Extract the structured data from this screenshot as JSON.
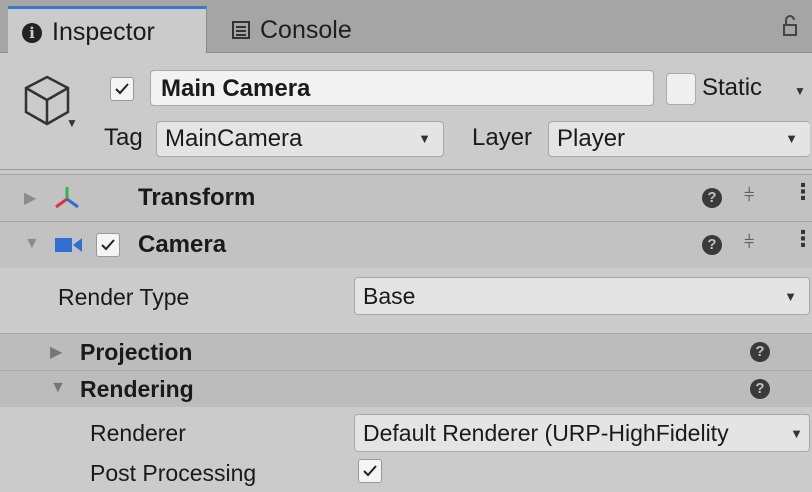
{
  "tabs": [
    {
      "label": "Inspector",
      "icon": "info-icon",
      "active": true
    },
    {
      "label": "Console",
      "icon": "console-icon",
      "active": false
    }
  ],
  "header": {
    "active": true,
    "name": "Main Camera",
    "static_label": "Static",
    "static_checked": false,
    "tag_label": "Tag",
    "tag_value": "MainCamera",
    "layer_label": "Layer",
    "layer_value": "Player"
  },
  "components": {
    "transform": {
      "title": "Transform",
      "expanded": false
    },
    "camera": {
      "title": "Camera",
      "expanded": true,
      "enabled": true
    }
  },
  "camera_props": {
    "render_type_label": "Render Type",
    "render_type_value": "Base",
    "projection_label": "Projection",
    "rendering_label": "Rendering",
    "renderer_label": "Renderer",
    "renderer_value": "Default Renderer (URP-HighFidelity",
    "post_processing_label": "Post Processing",
    "post_processing_checked": true
  },
  "colors": {
    "accent_tab": "#3a79c8",
    "camera_icon": "#2f6fd0",
    "axis_red": "#d4373a",
    "axis_green": "#3bb04a",
    "axis_blue": "#2f6fd0"
  }
}
